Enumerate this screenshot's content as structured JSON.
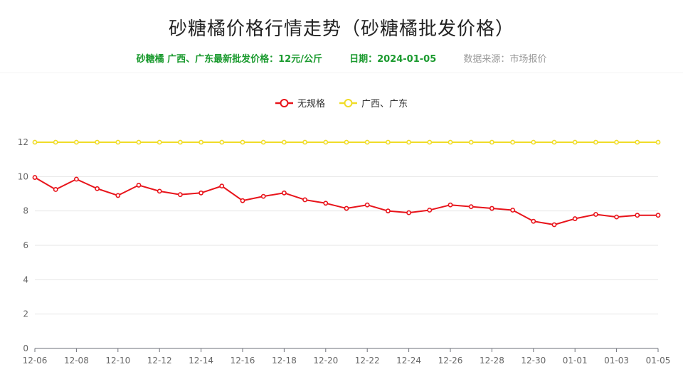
{
  "header": {
    "title": "砂糖橘价格行情走势（砂糖橘批发价格）",
    "price_note": "砂糖橘 广西、广东最新批发价格：12元/公斤",
    "date_note": "日期：2024-01-05",
    "source_note": "数据来源：市场报价"
  },
  "chart_data": {
    "type": "line",
    "title": "砂糖橘价格行情走势（砂糖橘批发价格）",
    "xlabel": "",
    "ylabel": "",
    "ylim": [
      0,
      12
    ],
    "yticks": [
      0,
      2,
      4,
      6,
      8,
      10,
      12
    ],
    "grid": true,
    "legend_position": "top-center",
    "categories": [
      "12-06",
      "12-07",
      "12-08",
      "12-09",
      "12-10",
      "12-11",
      "12-12",
      "12-13",
      "12-14",
      "12-15",
      "12-16",
      "12-17",
      "12-18",
      "12-19",
      "12-20",
      "12-21",
      "12-22",
      "12-23",
      "12-24",
      "12-25",
      "12-26",
      "12-27",
      "12-28",
      "12-29",
      "12-30",
      "12-31",
      "01-01",
      "01-02",
      "01-03",
      "01-04",
      "01-05"
    ],
    "tick_labels": [
      "12-06",
      "12-08",
      "12-10",
      "12-12",
      "12-14",
      "12-16",
      "12-18",
      "12-20",
      "12-22",
      "12-24",
      "12-26",
      "12-28",
      "12-30",
      "01-01",
      "01-03",
      "01-05"
    ],
    "series": [
      {
        "name": "无规格",
        "color": "#e8141b",
        "values": [
          9.95,
          9.25,
          9.85,
          9.3,
          8.9,
          9.5,
          9.15,
          8.95,
          9.05,
          9.45,
          8.6,
          8.85,
          9.05,
          8.65,
          8.45,
          8.15,
          8.35,
          8.0,
          7.9,
          8.05,
          8.35,
          8.25,
          8.15,
          8.05,
          7.4,
          7.2,
          7.55,
          7.8,
          7.65,
          7.75,
          7.75
        ]
      },
      {
        "name": "广西、广东",
        "color": "#f0dc28",
        "values": [
          12,
          12,
          12,
          12,
          12,
          12,
          12,
          12,
          12,
          12,
          12,
          12,
          12,
          12,
          12,
          12,
          12,
          12,
          12,
          12,
          12,
          12,
          12,
          12,
          12,
          12,
          12,
          12,
          12,
          12,
          12
        ]
      }
    ]
  }
}
